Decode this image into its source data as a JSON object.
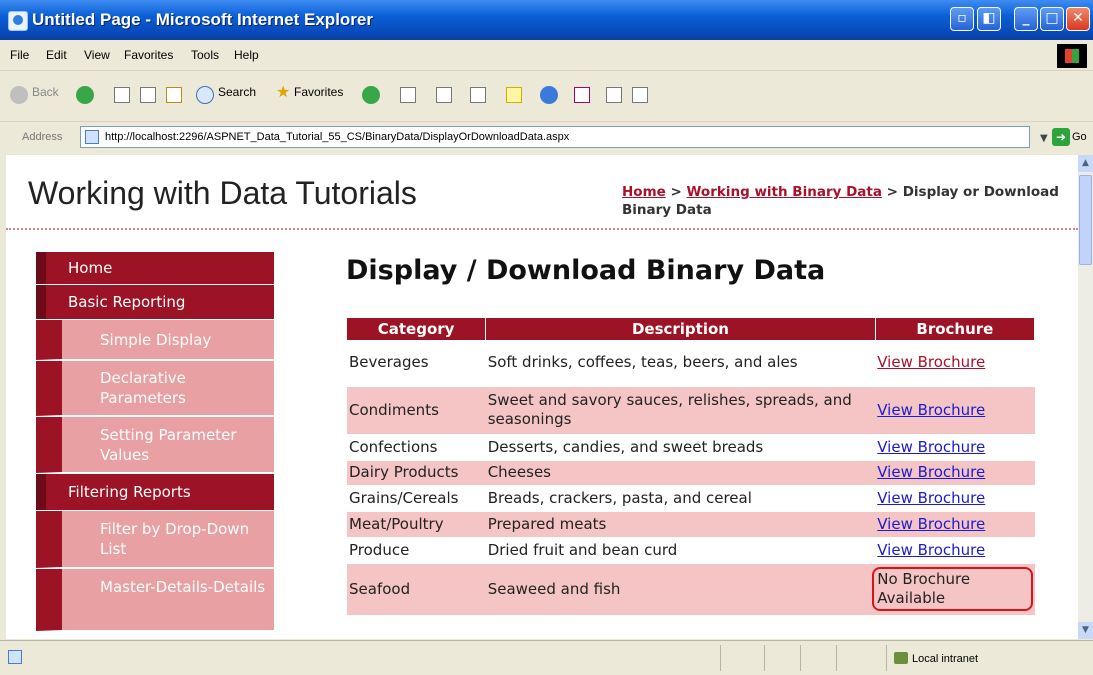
{
  "window": {
    "title": "Untitled Page - Microsoft Internet Explorer",
    "controls": [
      "restore-left",
      "restore",
      "minimize",
      "maximize",
      "close"
    ]
  },
  "menu": [
    "File",
    "Edit",
    "View",
    "Favorites",
    "Tools",
    "Help"
  ],
  "toolbar": {
    "back_label": "Back",
    "search_label": "Search",
    "favorites_label": "Favorites"
  },
  "address": {
    "label": "Address",
    "url": "http://localhost:2296/ASPNET_Data_Tutorial_55_CS/BinaryData/DisplayOrDownloadData.aspx",
    "go_label": "Go"
  },
  "site": {
    "title": "Working with Data Tutorials",
    "breadcrumb": {
      "home": "Home",
      "sep1": " > ",
      "section": "Working with Binary Data",
      "sep2": " > ",
      "current": "Display or Download Binary Data"
    }
  },
  "sidebar": {
    "items": [
      {
        "label": "Home",
        "level": "main"
      },
      {
        "label": "Basic Reporting",
        "level": "main"
      },
      {
        "label": "Simple Display",
        "level": "sub"
      },
      {
        "label": "Declarative Parameters",
        "level": "sub"
      },
      {
        "label": "Setting Parameter Values",
        "level": "sub"
      },
      {
        "label": "Filtering Reports",
        "level": "main"
      },
      {
        "label": "Filter by Drop-Down List",
        "level": "sub"
      },
      {
        "label": "Master-Details-Details",
        "level": "sub"
      }
    ]
  },
  "main": {
    "heading": "Display / Download Binary Data",
    "columns": [
      "Category",
      "Description",
      "Brochure"
    ],
    "rows": [
      {
        "category": "Beverages",
        "description": "Soft drinks, coffees, teas, beers, and ales",
        "brochure": "View Brochure"
      },
      {
        "category": "Condiments",
        "description": "Sweet and savory sauces, relishes, spreads, and seasonings",
        "brochure": "View Brochure"
      },
      {
        "category": "Confections",
        "description": "Desserts, candies, and sweet breads",
        "brochure": "View Brochure"
      },
      {
        "category": "Dairy Products",
        "description": "Cheeses",
        "brochure": "View Brochure"
      },
      {
        "category": "Grains/Cereals",
        "description": "Breads, crackers, pasta, and cereal",
        "brochure": "View Brochure"
      },
      {
        "category": "Meat/Poultry",
        "description": "Prepared meats",
        "brochure": "View Brochure"
      },
      {
        "category": "Produce",
        "description": "Dried fruit and bean curd",
        "brochure": "View Brochure"
      },
      {
        "category": "Seafood",
        "description": "Seaweed and fish",
        "brochure": "No Brochure Available"
      }
    ]
  },
  "status": {
    "zone": "Local intranet"
  },
  "colors": {
    "accent": "#9c1326",
    "alt_row": "#f5c5c6",
    "link": "#1b1bcf",
    "highlight": "#d8141b"
  }
}
